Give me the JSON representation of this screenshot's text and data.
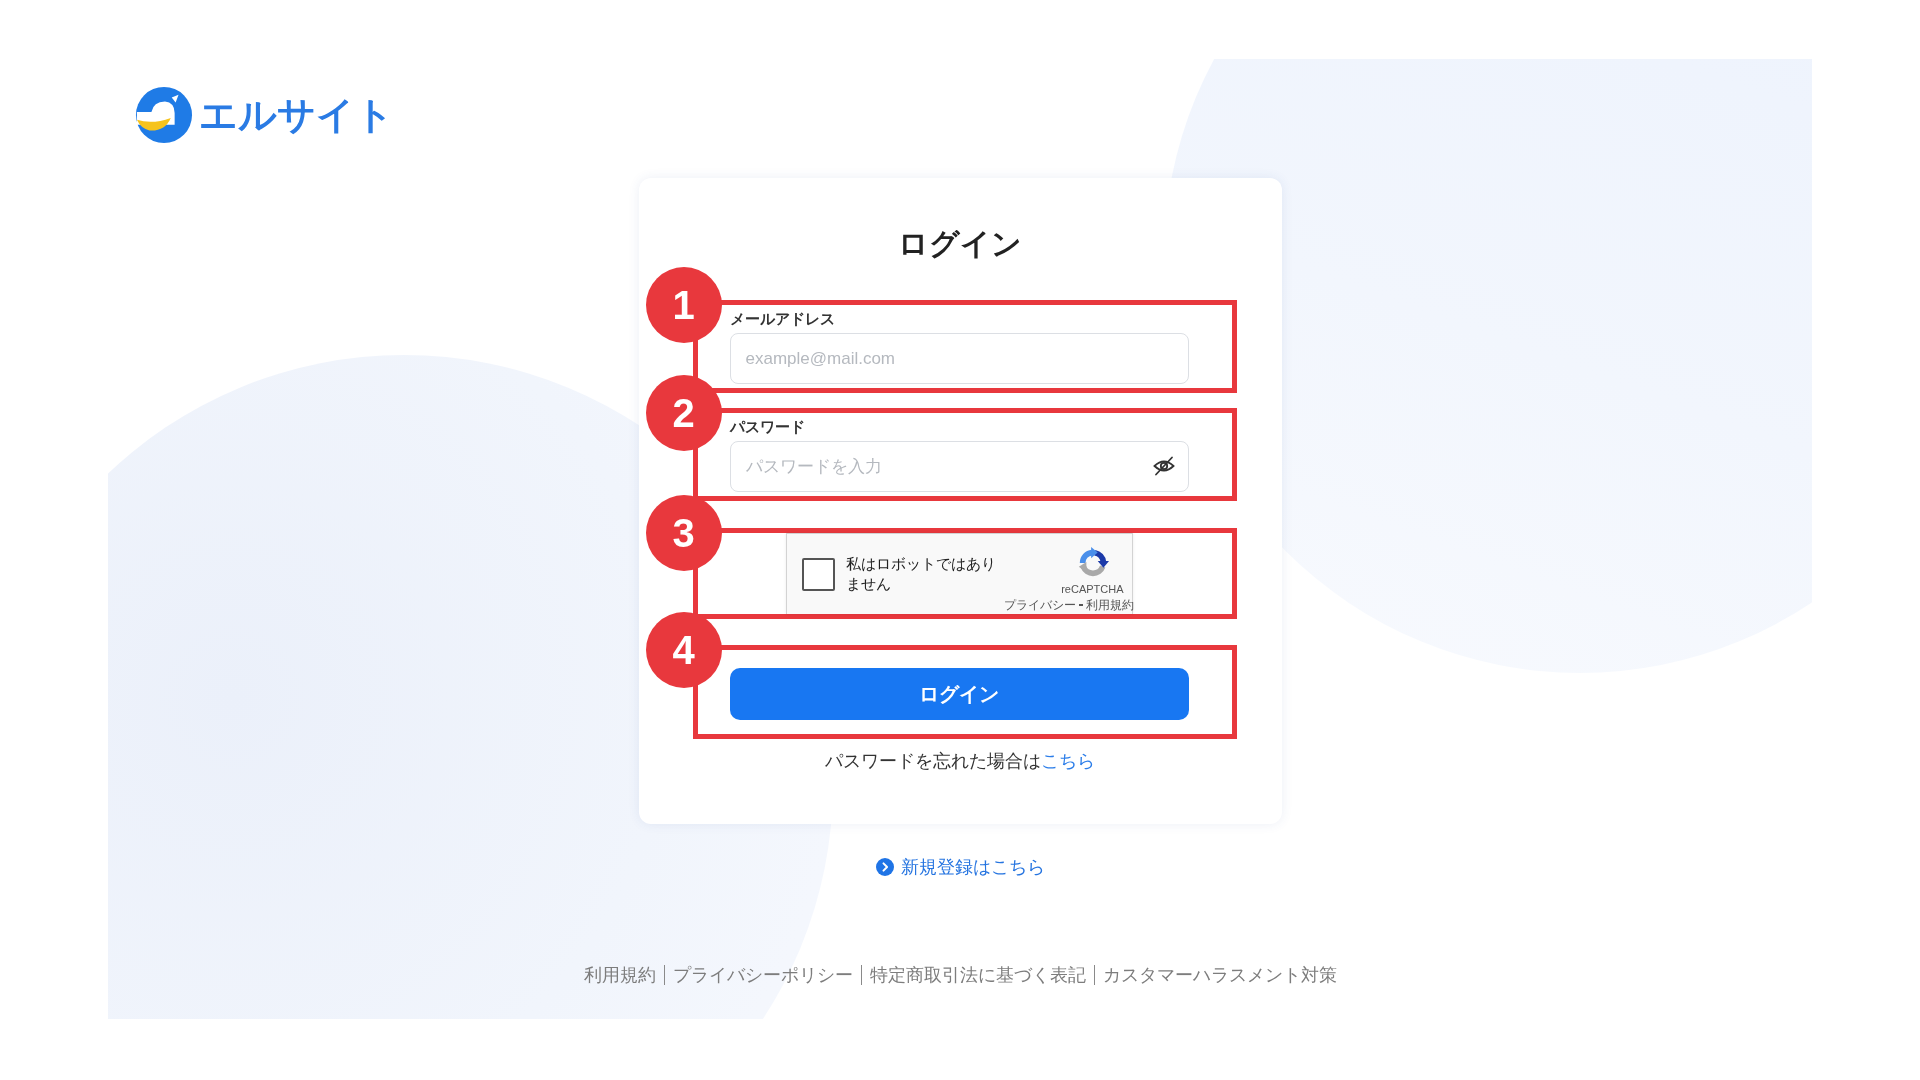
{
  "logo": {
    "text": "エルサイト"
  },
  "login_card": {
    "title": "ログイン",
    "sections": [
      {
        "kind": "email",
        "callout": "1",
        "label": "メールアドレス",
        "placeholder": "example@mail.com"
      },
      {
        "kind": "password",
        "callout": "2",
        "label": "パスワード",
        "placeholder": "パスワードを入力"
      },
      {
        "kind": "captcha",
        "callout": "3",
        "label": "私はロボットではありません",
        "checked": false,
        "brand": "reCAPTCHA",
        "privacy_link": "プライバシー",
        "terms_link": "利用規約"
      },
      {
        "kind": "button",
        "callout": "4",
        "label": "ログイン"
      }
    ],
    "forgot_password": {
      "text": "パスワードを忘れた場合は",
      "link": "こちら"
    }
  },
  "signup_link": "新規登録はこちら",
  "footer_links": [
    "利用規約",
    "プライバシーポリシー",
    "特定商取引法に基づく表記",
    "カスタマーハラスメント対策"
  ]
}
